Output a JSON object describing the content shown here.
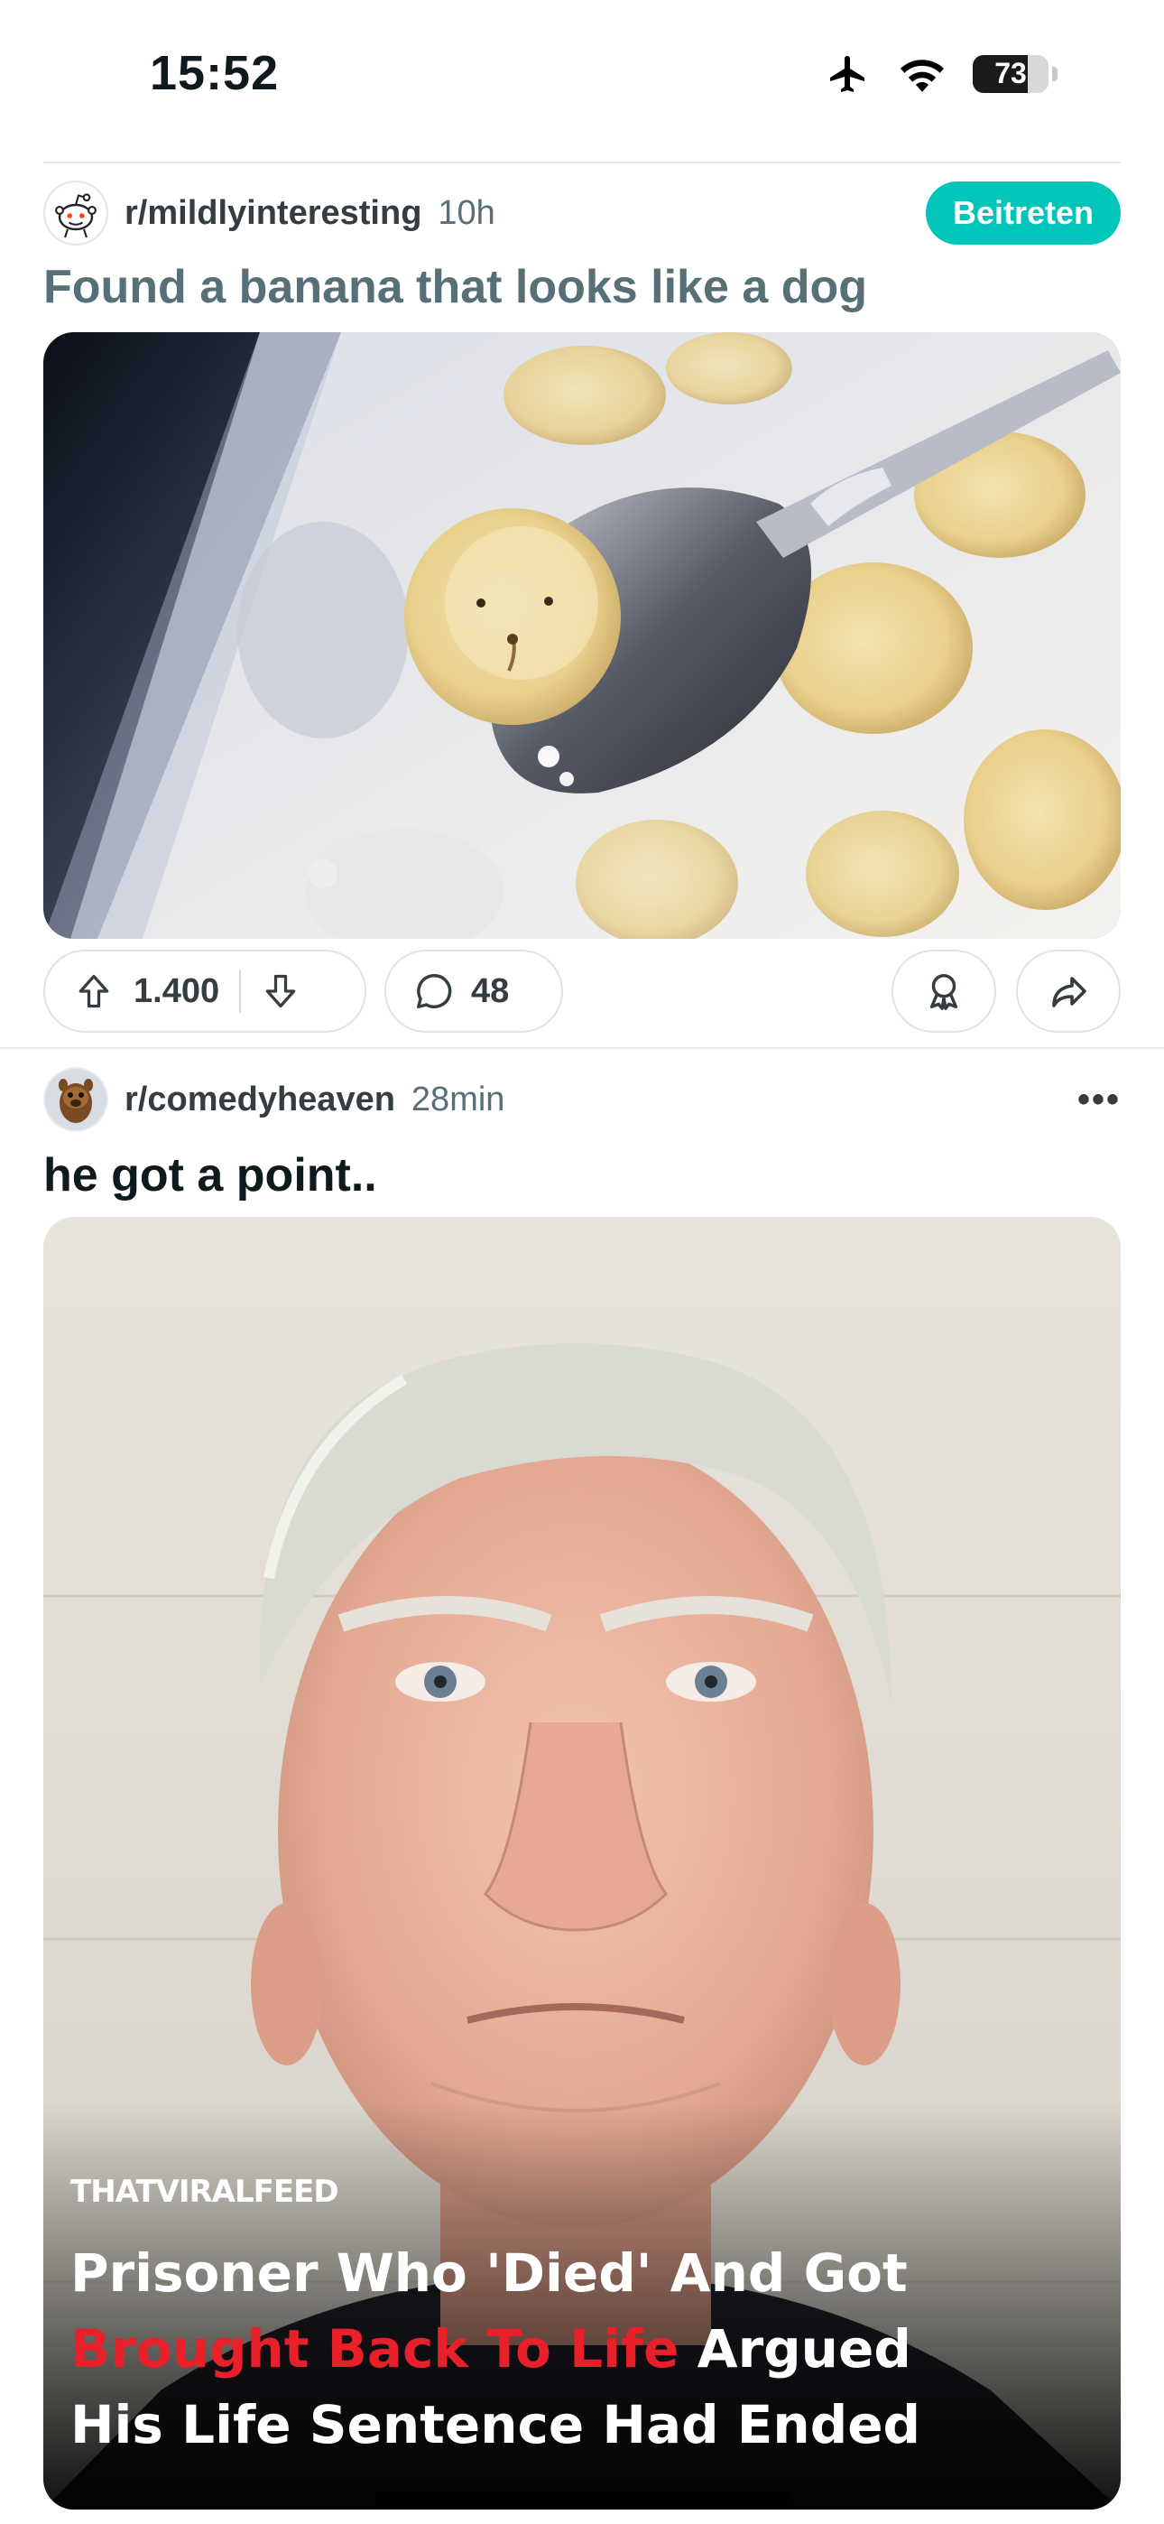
{
  "status_bar": {
    "time": "15:52",
    "battery_level": "73",
    "icons": [
      "airplane-icon",
      "wifi-icon",
      "battery-icon"
    ]
  },
  "posts": [
    {
      "subreddit": "r/mildlyinteresting",
      "age": "10h",
      "join_label": "Beitreten",
      "title": "Found a banana that looks like a dog",
      "upvotes": "1.400",
      "comments": "48"
    },
    {
      "subreddit": "r/comedyheaven",
      "age": "28min",
      "title": "he got a point..",
      "image_caption": {
        "source": "THATVIRALFEED",
        "line1": "Prisoner Who 'Died' And Got",
        "line2_red": "Brought Back To Life",
        "line2_rest": " Argued",
        "line3": "His Life Sentence Had Ended"
      }
    }
  ],
  "colors": {
    "accent_join": "#00c5b8",
    "text_primary": "#0f1a1c",
    "text_muted": "#576f76",
    "caption_red": "#e8202a"
  }
}
